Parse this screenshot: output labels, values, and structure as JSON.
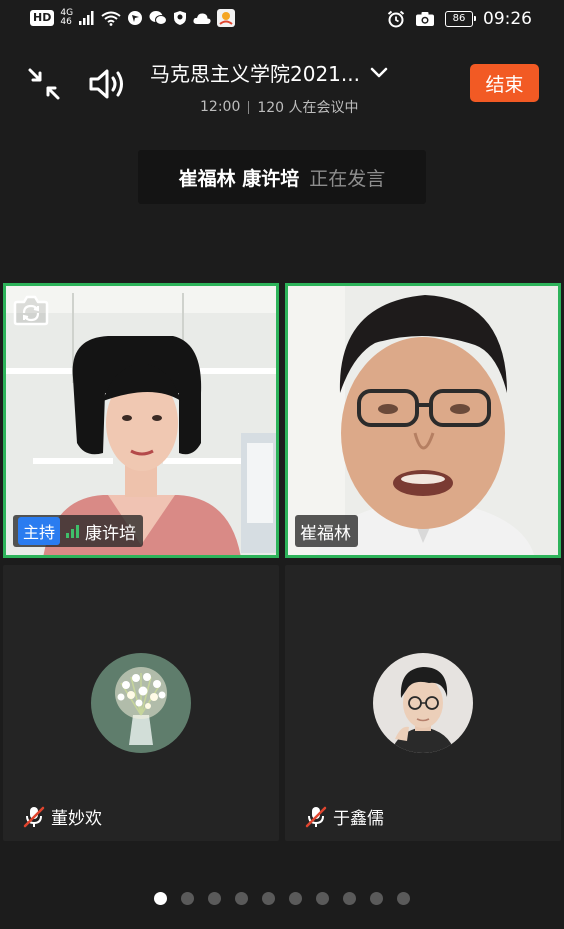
{
  "status_bar": {
    "hd": "HD",
    "network_top": "4G",
    "network_bottom": "46",
    "battery": "86",
    "time": "09:26"
  },
  "header": {
    "title": "马克思主义学院2021...",
    "time": "12:00",
    "participants": "120 人在会议中",
    "end_button": "结束"
  },
  "speaking": {
    "names": "崔福林 康许培",
    "status": "正在发言"
  },
  "tiles": [
    {
      "name": "康许培",
      "host_badge": "主持",
      "video": true
    },
    {
      "name": "崔福林",
      "video": true
    },
    {
      "name": "董妙欢",
      "video": false,
      "muted": true,
      "avatar": "flower-bouquet"
    },
    {
      "name": "于鑫儒",
      "video": false,
      "muted": true,
      "avatar": "man-with-glasses"
    }
  ],
  "pagination": {
    "total": 10,
    "active": 0
  },
  "colors": {
    "background": "#1c1c1c",
    "end_button": "#f25a24",
    "active_speaker_border": "#2db35a",
    "host_badge": "#2a7cf0",
    "muted_mic": "#e0452f"
  }
}
